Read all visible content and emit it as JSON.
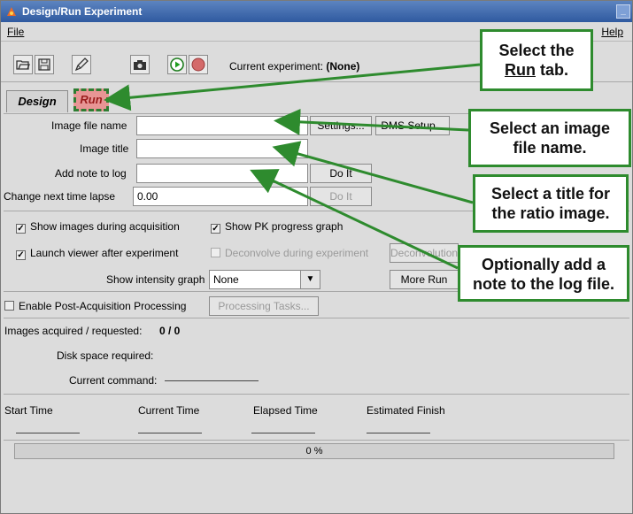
{
  "window": {
    "title": "Design/Run Experiment",
    "minimize_glyph": "_"
  },
  "menu": {
    "file": "File",
    "help": "Help"
  },
  "toolbar": {
    "icons": [
      "open-icon",
      "save-icon",
      "edit-icon",
      "camera-icon",
      "play-icon",
      "stop-icon"
    ],
    "current_label": "Current experiment:",
    "current_value": "(None)"
  },
  "tabs": {
    "design": "Design",
    "run": "Run",
    "active": "Run"
  },
  "form": {
    "image_file_label": "Image file name",
    "image_file_value": "",
    "settings_button": "Settings...",
    "dms_button": "DMS Setup...",
    "image_title_label": "Image title",
    "image_title_value": "",
    "note_label": "Add note to log",
    "note_value": "",
    "note_do_it": "Do It",
    "lapse_label": "Change next time lapse",
    "lapse_value": "0.00",
    "lapse_do_it": "Do It"
  },
  "options": {
    "show_images": {
      "label": "Show images during acquisition",
      "checked": true
    },
    "show_pk": {
      "label": "Show PK progress graph",
      "checked": true
    },
    "launch_viewer": {
      "label": "Launch viewer after experiment",
      "checked": true
    },
    "deconvolve": {
      "label": "Deconvolve during experiment",
      "checked": false,
      "enabled": false
    },
    "deconvolution_button": "Deconvolution",
    "intensity_label": "Show intensity graph",
    "intensity_value": "None",
    "more_run_button": "More Run",
    "post_acq": {
      "label": "Enable Post-Acquisition Processing",
      "checked": false
    },
    "processing_tasks_button": "Processing Tasks..."
  },
  "status": {
    "images_label": "Images acquired / requested:",
    "images_value": "0 / 0",
    "disk_label": "Disk space required:",
    "command_label": "Current command:"
  },
  "timing": {
    "start": "Start Time",
    "current": "Current Time",
    "elapsed": "Elapsed Time",
    "estimated": "Estimated Finish"
  },
  "progress": {
    "label": "0 %",
    "fraction": 0
  },
  "callouts": {
    "run_tab_1": "Select the",
    "run_tab_2": "Run",
    "run_tab_3": " tab.",
    "file_name_1": "Select an image",
    "file_name_2": "file name.",
    "title_1": "Select a title for",
    "title_2": "the ratio image.",
    "note_1": "Optionally add a",
    "note_2": "note to the log file."
  },
  "colors": {
    "callout_border": "#2e8b2e",
    "run_tab": "#e89595",
    "titlebar": "#2f5aa0"
  }
}
